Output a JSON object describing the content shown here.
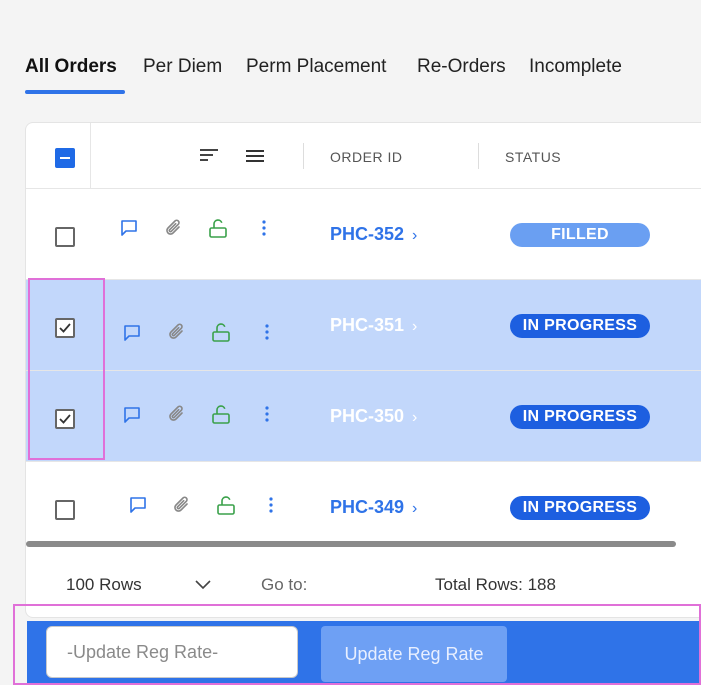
{
  "tabs": [
    {
      "label": "All Orders",
      "active": true
    },
    {
      "label": "Per Diem",
      "active": false
    },
    {
      "label": "Perm Placement",
      "active": false
    },
    {
      "label": "Re-Orders",
      "active": false
    },
    {
      "label": "Incomplete",
      "active": false
    }
  ],
  "table": {
    "columns": {
      "order_id": "ORDER ID",
      "status": "STATUS"
    },
    "header_icons": [
      "sort-icon",
      "columns-menu-icon"
    ],
    "row_icons": [
      "comment-icon",
      "attachment-icon",
      "unlock-icon",
      "more-vertical-icon"
    ],
    "rows": [
      {
        "order_id": "PHC-352",
        "status": "FILLED",
        "checked": false
      },
      {
        "order_id": "PHC-351",
        "status": "IN PROGRESS",
        "checked": true
      },
      {
        "order_id": "PHC-350",
        "status": "IN PROGRESS",
        "checked": true
      },
      {
        "order_id": "PHC-349",
        "status": "IN PROGRESS",
        "checked": false
      }
    ]
  },
  "footer": {
    "rows_per_page": "100 Rows",
    "goto_label": "Go to:",
    "total_rows": "Total Rows: 188"
  },
  "bulk_action": {
    "input_placeholder": "-Update Reg Rate-",
    "button_label": "Update Reg Rate"
  },
  "colors": {
    "accent": "#2f73e8",
    "selected_row": "#c2d7fb",
    "status_filled": "#6a9ff2",
    "status_in_progress": "#1d5fe0",
    "unlock_icon": "#3aa14a",
    "highlight": "#e070d8"
  }
}
